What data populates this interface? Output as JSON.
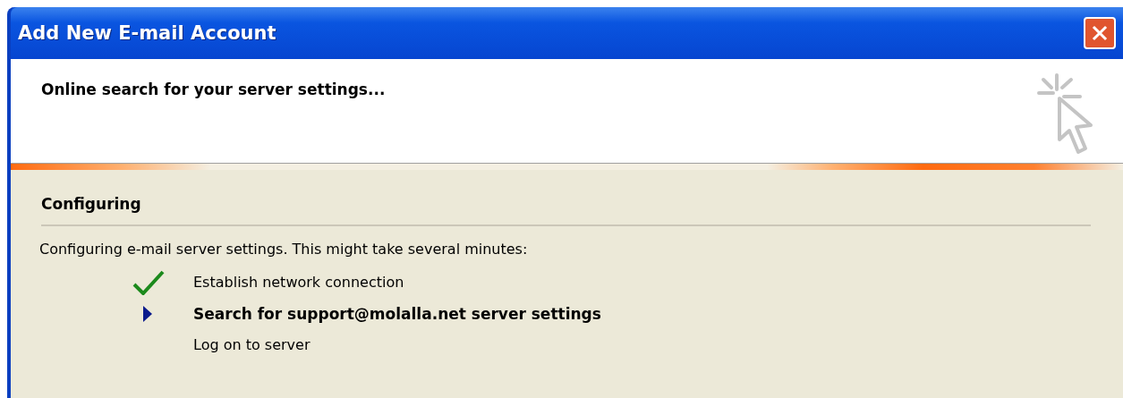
{
  "window": {
    "title": "Add New E-mail Account"
  },
  "header": {
    "heading": "Online search for your server settings..."
  },
  "section": {
    "title": "Configuring",
    "intro": "Configuring e-mail server settings. This might take several minutes:"
  },
  "steps": [
    {
      "label": "Establish network connection",
      "kind": "done"
    },
    {
      "label": "Search for support@molalla.net server settings",
      "kind": "current"
    },
    {
      "label": "Log on to server",
      "kind": "pending"
    }
  ]
}
